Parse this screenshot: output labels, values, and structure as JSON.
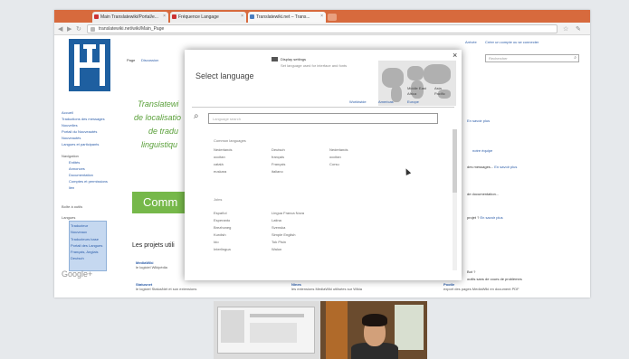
{
  "browser": {
    "tabs": [
      {
        "label": "Main Translatewiki/Portal/e..."
      },
      {
        "label": "Fréquence Langage"
      },
      {
        "label": "Translatewiki.net – Trans..."
      }
    ],
    "url": "translatewiki.net/wiki/Main_Page"
  },
  "page": {
    "top_links": {
      "user": "Arrivée",
      "login": "Créer un compte ou se connecter"
    },
    "page_tab": "Page",
    "discussion_tab": "Discussion",
    "search_placeholder": "Rechercher",
    "hero": [
      "Translatewi",
      "de localisatio",
      "de tradu",
      "linguistiqu"
    ],
    "comm_button": "Comm",
    "projects_title": "Les projets utili",
    "sidebar": {
      "links": [
        "Accueil",
        "Traductions des messages",
        "Nouvelles",
        "Portail du Nouveautés",
        "Nouveautés",
        "Langues et participants"
      ],
      "nav_head": "Navigation",
      "nav_links": [
        "Entités",
        "Annonces",
        "Documentation",
        "Comptes et permissions",
        "lien"
      ],
      "tools_head": "Boîte à outils",
      "lang_head": "Langues",
      "lang_items": [
        "Traducteur",
        "Nouveaux",
        "Traducteurs base",
        "Portail des Langues",
        "Français, Anglais",
        "Deutsch"
      ]
    },
    "projects": [
      {
        "name": "MediaWiki",
        "desc": "le logiciel Wikipédia"
      },
      {
        "name": "Statusnet",
        "desc": "le logiciel StatusNet et son extensions"
      },
      {
        "name": "Nines",
        "desc": "les extensions MediaWiki utilisées sur Wikia"
      },
      {
        "name": "Pootle",
        "desc": "export des pages MediaWiki en document PDF"
      }
    ],
    "right_links": [
      {
        "text": "",
        "link": "En savoir plus"
      },
      {
        "text": "",
        "link": "notre équipe"
      },
      {
        "text": "des messages...",
        "link": "En savoir plus"
      },
      {
        "text": "de documentation...",
        "link": ""
      },
      {
        "text": "projet ?",
        "link": "En savoir plus"
      },
      {
        "text": "Bot ?",
        "link": ""
      },
      {
        "text": "outils sans de cours de problèmes",
        "link": ""
      }
    ],
    "gplus": "Google+"
  },
  "language_selector": {
    "title": "Select language",
    "display_settings": "Display settings",
    "display_sub": "Set language used for interface and fonts",
    "close": "×",
    "search_placeholder": "Language search",
    "regions": [
      "Worldwide",
      "Americas",
      "Europe",
      "Middle East",
      "Africa",
      "Asia",
      "Pacific"
    ],
    "common_heading": "Common languages",
    "common_languages": [
      [
        "Nederlands",
        "Deutsch",
        "Nederlands"
      ],
      [
        "occitan",
        "français",
        "occitan"
      ],
      [
        "català",
        "Français",
        "Corsu"
      ],
      [
        "euskara",
        "italiano",
        ""
      ]
    ],
    "section_heading": "Joins",
    "more_languages": [
      [
        "Español",
        "Lingua Franca Nova"
      ],
      [
        "Esperanto",
        "Latina"
      ],
      [
        "Brezhoneg",
        "Svenska"
      ],
      [
        "Kurdish",
        "Simple English"
      ],
      [
        "Ido",
        "Tok Pisin"
      ],
      [
        "Interlingua",
        "Walon"
      ]
    ]
  }
}
